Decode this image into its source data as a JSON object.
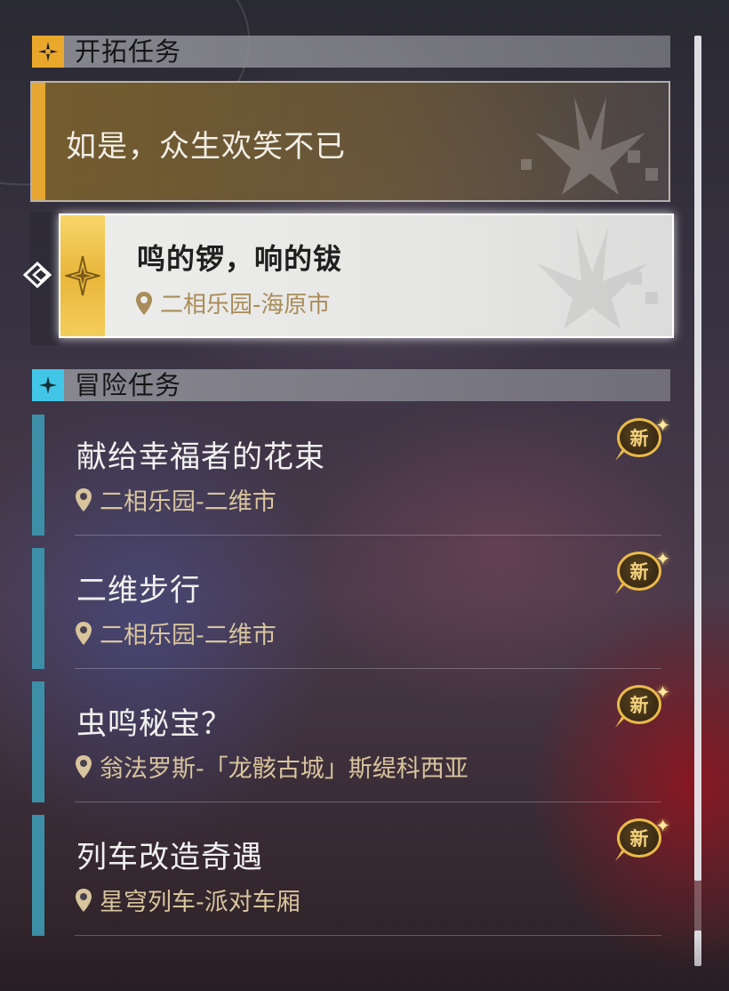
{
  "trailblaze_section": {
    "title": "开拓任务",
    "main_mission": {
      "title": "如是，众生欢笑不已"
    },
    "selected_mission": {
      "title": "鸣的锣，响的钹",
      "location": "二相乐园-海原市"
    }
  },
  "adventure_section": {
    "title": "冒险任务",
    "missions": [
      {
        "title": "献给幸福者的花束",
        "location": "二相乐园-二维市",
        "badge": "新"
      },
      {
        "title": "二维步行",
        "location": "二相乐园-二维市",
        "badge": "新"
      },
      {
        "title": "虫鸣秘宝？",
        "location": "翁法罗斯-「龙骸古城」斯缇科西亚",
        "badge": "新"
      },
      {
        "title": "列车改造奇遇",
        "location": "星穹列车-派对车厢",
        "badge": "新"
      }
    ]
  },
  "colors": {
    "trailblaze_accent": "#e9a72c",
    "adventure_accent": "#42c6e7",
    "adventure_bar": "#3d8fa7",
    "location_text": "#d8c49d",
    "new_badge_gold": "#e9b949"
  },
  "icons": {
    "trailblaze_badge": "four-point-star-icon",
    "adventure_badge": "sparkle-icon",
    "location": "map-pin-icon",
    "selection_pointer": "diamond-arrow-icon"
  }
}
